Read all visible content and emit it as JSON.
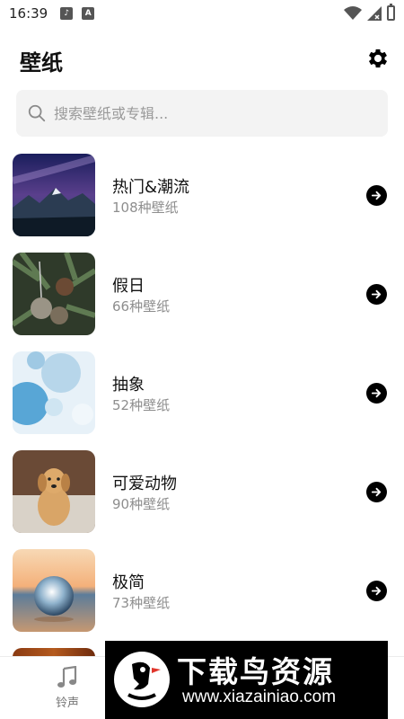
{
  "status_bar": {
    "time": "16:39",
    "notification_icons": [
      "music-note-icon",
      "app-a-icon"
    ],
    "system_icons": [
      "wifi-icon",
      "signal-icon",
      "battery-icon"
    ]
  },
  "header": {
    "title": "壁纸",
    "settings_icon": "gear-icon"
  },
  "search": {
    "placeholder": "搜索壁纸或专辑..."
  },
  "categories": [
    {
      "title": "热门&潮流",
      "count": "108种壁纸",
      "thumbnail": "night-sky-mountains"
    },
    {
      "title": "假日",
      "count": "66种壁纸",
      "thumbnail": "christmas-ornaments"
    },
    {
      "title": "抽象",
      "count": "52种壁纸",
      "thumbnail": "blue-bubbles"
    },
    {
      "title": "可爱动物",
      "count": "90种壁纸",
      "thumbnail": "golden-puppy"
    },
    {
      "title": "极简",
      "count": "73种壁纸",
      "thumbnail": "glass-sphere-sunset"
    }
  ],
  "bottom_nav": {
    "items": [
      {
        "label": "铃声",
        "icon": "music-note-icon"
      }
    ]
  },
  "watermark": {
    "title": "下载鸟资源",
    "url": "www.xiazainiao.com"
  },
  "colors": {
    "background": "#ffffff",
    "search_bg": "#f3f3f3",
    "secondary_text": "#8e8e8e",
    "arrow_button": "#000000"
  }
}
